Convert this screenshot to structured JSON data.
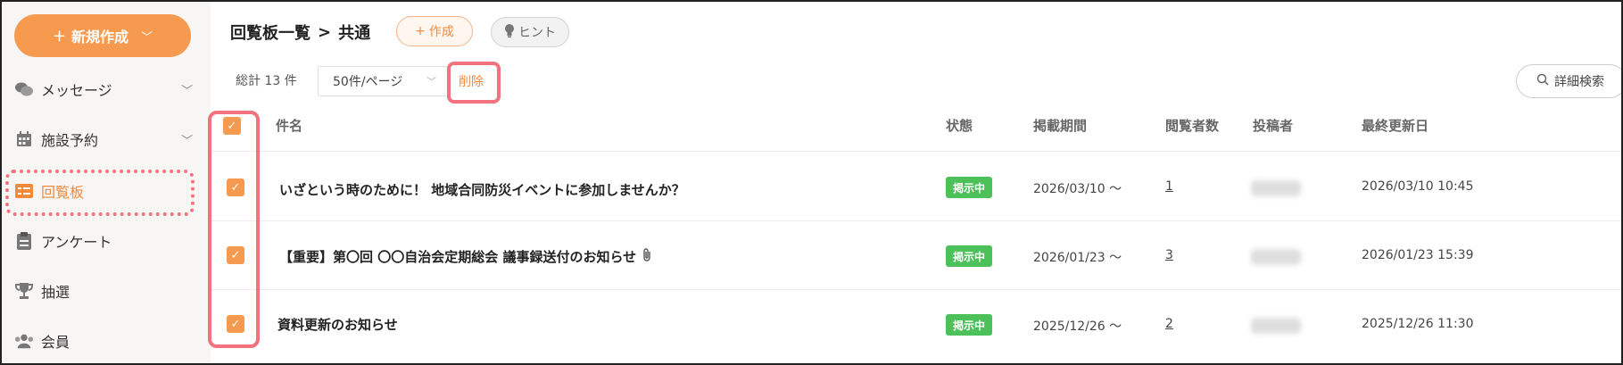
{
  "sidebar": {
    "new_button": "新規作成",
    "items": [
      {
        "label": "メッセージ",
        "icon": "chat-bubbles-icon",
        "has_chevron": true
      },
      {
        "label": "施設予約",
        "icon": "calendar-icon",
        "has_chevron": true
      },
      {
        "label": "回覧板",
        "icon": "board-icon",
        "active": true
      },
      {
        "label": "アンケート",
        "icon": "clipboard-icon"
      },
      {
        "label": "抽選",
        "icon": "trophy-icon"
      },
      {
        "label": "会員",
        "icon": "members-icon"
      }
    ]
  },
  "header": {
    "breadcrumb_parent": "回覧板一覧",
    "breadcrumb_separator": ">",
    "breadcrumb_current": "共通",
    "create_label": "作成",
    "hint_label": "ヒント"
  },
  "toolbar": {
    "total": "総計 13 件",
    "per_page": "50件/ページ",
    "delete_label": "削除",
    "detail_search": "詳細検索"
  },
  "table": {
    "columns": [
      "件名",
      "状態",
      "掲載期間",
      "閲覧者数",
      "投稿者",
      "最終更新日"
    ],
    "rows": [
      {
        "subject": "いざという時のために！ 地域合同防災イベントに参加しませんか？",
        "status": "掲示中",
        "period": "2026/03/10 〜",
        "viewers": "1",
        "updated": "2026/03/10 10:45",
        "attachment": false
      },
      {
        "subject": "【重要】第〇回 〇〇自治会定期総会 議事録送付のお知らせ",
        "status": "掲示中",
        "period": "2026/01/23 〜",
        "viewers": "3",
        "updated": "2026/01/23 15:39",
        "attachment": true
      },
      {
        "subject": "資料更新のお知らせ",
        "status": "掲示中",
        "period": "2025/12/26 〜",
        "viewers": "2",
        "updated": "2025/12/26 11:30",
        "attachment": false
      }
    ]
  },
  "colors": {
    "accent": "#f59a4f",
    "highlight": "#f2727e",
    "status_green": "#4cc15a"
  }
}
